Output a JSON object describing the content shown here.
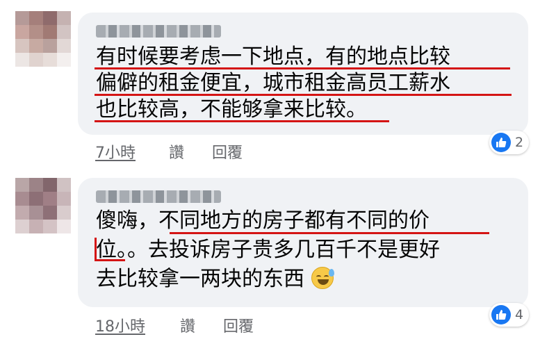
{
  "comments": [
    {
      "author": "",
      "lines": [
        "有时候要考虑一下地点，有的地点比较",
        "偏僻的租金便宜，城市租金高员工薪水",
        "也比较高，不能够拿来比较。"
      ],
      "time": "7小時",
      "like_label": "讚",
      "reply_label": "回覆",
      "reaction_count": "2"
    },
    {
      "author": "",
      "lines": [
        "傻嗨，不同地方的房子都有不同的价",
        "位。。去投诉房子贵多几百千不是更好",
        "去比较拿一两块的东西"
      ],
      "emoji": "sweat-smile-emoji",
      "time": "18小時",
      "like_label": "讚",
      "reply_label": "回覆",
      "reaction_count": "4"
    }
  ],
  "colors": {
    "bubble": "#f0f2f5",
    "underline": "#d41414",
    "like": "#1877f2",
    "meta": "#65676b"
  }
}
